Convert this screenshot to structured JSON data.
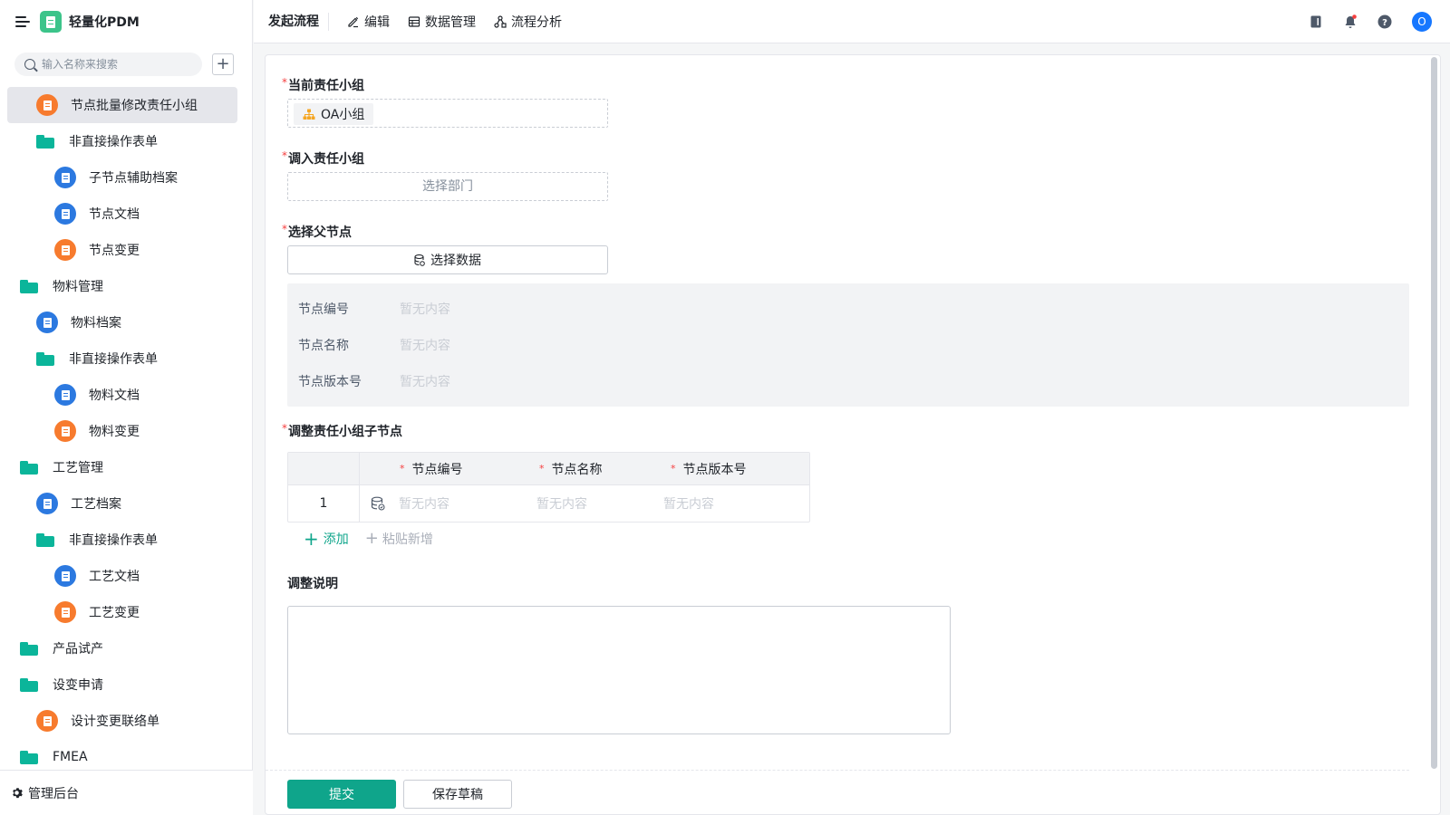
{
  "app": {
    "name": "轻量化PDM"
  },
  "search": {
    "placeholder": "输入名称来搜索",
    "value": ""
  },
  "sidebar": {
    "items": [
      {
        "label": "节点批量修改责任小组",
        "type": "doc",
        "color": "orange",
        "level": 1,
        "active": true
      },
      {
        "label": "非直接操作表单",
        "type": "folder",
        "level": 1
      },
      {
        "label": "子节点辅助档案",
        "type": "doc",
        "color": "blue",
        "level": 2
      },
      {
        "label": "节点文档",
        "type": "doc",
        "color": "blue",
        "level": 2
      },
      {
        "label": "节点变更",
        "type": "doc",
        "color": "orange",
        "level": 2
      },
      {
        "label": "物料管理",
        "type": "folder",
        "level": 0
      },
      {
        "label": "物料档案",
        "type": "doc",
        "color": "blue",
        "level": 1
      },
      {
        "label": "非直接操作表单",
        "type": "folder",
        "level": 1
      },
      {
        "label": "物料文档",
        "type": "doc",
        "color": "blue",
        "level": 2
      },
      {
        "label": "物料变更",
        "type": "doc",
        "color": "orange",
        "level": 2
      },
      {
        "label": "工艺管理",
        "type": "folder",
        "level": 0
      },
      {
        "label": "工艺档案",
        "type": "doc",
        "color": "blue",
        "level": 1
      },
      {
        "label": "非直接操作表单",
        "type": "folder",
        "level": 1
      },
      {
        "label": "工艺文档",
        "type": "doc",
        "color": "blue",
        "level": 2
      },
      {
        "label": "工艺变更",
        "type": "doc",
        "color": "orange",
        "level": 2
      },
      {
        "label": "产品试产",
        "type": "folder",
        "level": 0
      },
      {
        "label": "设变申请",
        "type": "folder",
        "level": 0
      },
      {
        "label": "设计变更联络单",
        "type": "doc",
        "color": "orange",
        "level": 1
      },
      {
        "label": "FMEA",
        "type": "folder",
        "level": 0
      }
    ],
    "admin_label": "管理后台"
  },
  "toolbar": {
    "title": "发起流程",
    "edit": "编辑",
    "data_manage": "数据管理",
    "flow_analysis": "流程分析",
    "avatar_initial": "O"
  },
  "form": {
    "current_group": {
      "label": "当前责任小组",
      "tag": "OA小组"
    },
    "target_group": {
      "label": "调入责任小组",
      "placeholder": "选择部门"
    },
    "parent_node": {
      "label": "选择父节点",
      "button": "选择数据",
      "fields": [
        {
          "key": "节点编号",
          "value": "暂无内容"
        },
        {
          "key": "节点名称",
          "value": "暂无内容"
        },
        {
          "key": "节点版本号",
          "value": "暂无内容"
        }
      ]
    },
    "child_nodes": {
      "label": "调整责任小组子节点",
      "columns": [
        "节点编号",
        "节点名称",
        "节点版本号"
      ],
      "rows": [
        {
          "index": "1",
          "c1": "暂无内容",
          "c2": "暂无内容",
          "c3": "暂无内容"
        }
      ],
      "add_label": "添加",
      "paste_label": "粘贴新增"
    },
    "note": {
      "label": "调整说明",
      "value": ""
    }
  },
  "actions": {
    "submit": "提交",
    "draft": "保存草稿"
  },
  "colors": {
    "primary": "#0fa58b",
    "folder": "#0bb59a",
    "doc_orange": "#f77b2e",
    "doc_blue": "#2c79e0",
    "avatar": "#1677ff",
    "required": "#f53f3f"
  }
}
